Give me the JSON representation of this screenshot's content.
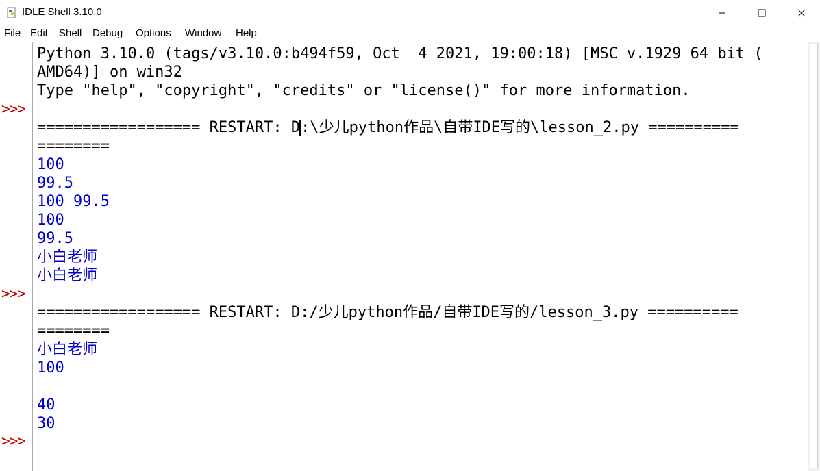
{
  "window": {
    "title": "IDLE Shell 3.10.0",
    "minimize_icon": "minimize-icon",
    "maximize_icon": "maximize-icon",
    "close_icon": "close-icon"
  },
  "menu": [
    "File",
    "Edit",
    "Shell",
    "Debug",
    "Options",
    "Window",
    "Help"
  ],
  "prompts": [
    ">>>",
    ">>>",
    ">>>"
  ],
  "lines": [
    {
      "text": "Python 3.10.0 (tags/v3.10.0:b494f59, Oct  4 2021, 19:00:18) [MSC v.1929 64 bit (",
      "kind": "header"
    },
    {
      "text": "AMD64)] on win32",
      "kind": "header"
    },
    {
      "text": "Type \"help\", \"copyright\", \"credits\" or \"license()\" for more information.",
      "kind": "header"
    },
    {
      "text": "",
      "kind": "blank"
    },
    {
      "text": "================== RESTART: D:\\少儿python作品\\自带IDE写的\\lesson_2.py ==========",
      "kind": "restart"
    },
    {
      "text": "========",
      "kind": "restart"
    },
    {
      "text": "100",
      "kind": "output"
    },
    {
      "text": "99.5",
      "kind": "output"
    },
    {
      "text": "100 99.5",
      "kind": "output"
    },
    {
      "text": "100",
      "kind": "output"
    },
    {
      "text": "99.5",
      "kind": "output"
    },
    {
      "text": "小白老师",
      "kind": "output"
    },
    {
      "text": "小白老师",
      "kind": "output"
    },
    {
      "text": "",
      "kind": "blank"
    },
    {
      "text": "================== RESTART: D:/少儿python作品/自带IDE写的/lesson_3.py ==========",
      "kind": "restart"
    },
    {
      "text": "========",
      "kind": "restart"
    },
    {
      "text": "小白老师",
      "kind": "output"
    },
    {
      "text": "100",
      "kind": "output"
    },
    {
      "text": "",
      "kind": "blank"
    },
    {
      "text": "40",
      "kind": "output"
    },
    {
      "text": "30",
      "kind": "output"
    }
  ],
  "colors": {
    "prompt": "#c00000",
    "output": "#0000cd",
    "text": "#000000"
  }
}
